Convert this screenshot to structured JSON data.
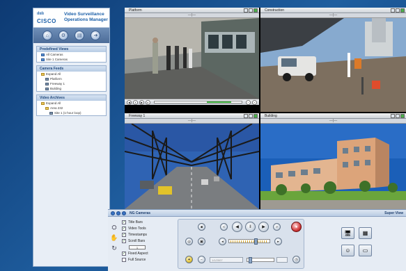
{
  "app": {
    "brand": "CISCO",
    "brand_bars": "ılıılı",
    "title_line1": "Video Surveillance",
    "title_line2": "Operations Manager"
  },
  "left_panel": {
    "sections": [
      {
        "title": "Predefined Views",
        "items": [
          {
            "label": "All Cameras",
            "level": 1,
            "icon": "view-icon"
          },
          {
            "label": "Site 1 Cameras",
            "level": 1,
            "icon": "view-icon"
          }
        ]
      },
      {
        "title": "Camera Feeds",
        "items": [
          {
            "label": "Expand All",
            "level": 1,
            "icon": "folder-icon"
          },
          {
            "label": "Platform",
            "level": 2,
            "icon": "camera-icon"
          },
          {
            "label": "Freeway 1",
            "level": 2,
            "icon": "camera-icon"
          },
          {
            "label": "Building",
            "level": 2,
            "icon": "camera-icon"
          }
        ]
      },
      {
        "title": "Video Archives",
        "items": [
          {
            "label": "Expand All",
            "level": 1,
            "icon": "folder-icon"
          },
          {
            "label": "Area 232",
            "level": 2,
            "icon": "folder-icon"
          },
          {
            "label": "Site 1 (1-hour loop)",
            "level": 3,
            "icon": "camera-icon"
          }
        ]
      }
    ]
  },
  "panes": {
    "platform": {
      "title": "Platform"
    },
    "construction": {
      "title": "Construction"
    },
    "freeway": {
      "title": "Freeway 1"
    },
    "building": {
      "title": "Building"
    },
    "divider_glyph": "—|—"
  },
  "bottom_panel": {
    "title": "NG Cameras",
    "right_label": "Super View",
    "options": [
      {
        "label": "Title Bars",
        "checked": true
      },
      {
        "label": "Video Tools",
        "checked": true
      },
      {
        "label": "Timestamps",
        "checked": true
      },
      {
        "label": "Scroll Bars",
        "checked": true
      },
      {
        "label": "Fixed Aspect",
        "checked": true
      },
      {
        "label": "Full Source",
        "checked": false
      }
    ],
    "stepper_value": "1",
    "field_placeholder": "1/1/2007"
  },
  "colors": {
    "background": "#1f5e9f",
    "accent": "#1b5fa8",
    "progress": "#52c152",
    "record": "#d23b3b"
  }
}
